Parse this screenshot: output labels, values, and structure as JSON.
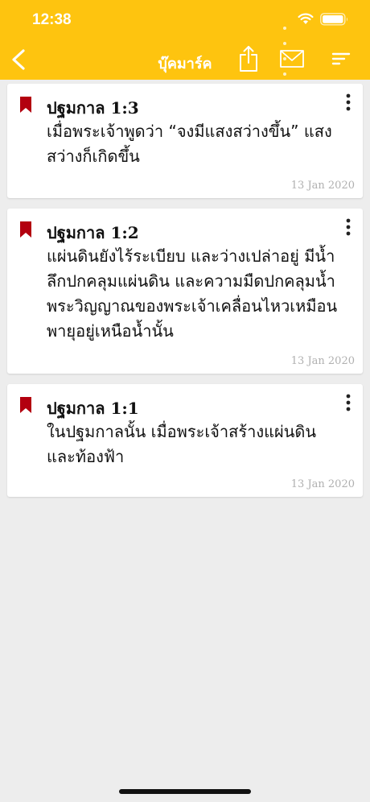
{
  "status_bar": {
    "time": "12:38"
  },
  "nav": {
    "title": "บุ๊คมาร์ค",
    "back_icon": "chevron-left-icon",
    "share_icon": "share-icon",
    "mail_icon": "mail-icon",
    "sort_icon": "sort-icon"
  },
  "colors": {
    "header": "#fec40f",
    "bookmark": "#b3000f",
    "background": "#ededed"
  },
  "bookmarks": [
    {
      "reference": "ปฐมกาล 1:3",
      "text": "เมื่อพระเจ้าพูดว่า “จงมีแสงสว่างขึ้น” แสงสว่างก็เกิดขึ้น",
      "date": "13 Jan 2020"
    },
    {
      "reference": "ปฐมกาล 1:2",
      "text": "แผ่นดินยังไร้ระเบียบ และว่างเปล่าอยู่ มีน้ำลึกปกคลุมแผ่นดิน และความมืดปกคลุมน้ำ พระวิญญาณของพระเจ้าเคลื่อนไหวเหมือนพายุอยู่เหนือน้ำนั้น",
      "date": "13 Jan 2020"
    },
    {
      "reference": "ปฐมกาล 1:1",
      "text": "ในปฐมกาลนั้น เมื่อพระเจ้าสร้างแผ่นดินและท้องฟ้า",
      "date": "13 Jan 2020"
    }
  ]
}
